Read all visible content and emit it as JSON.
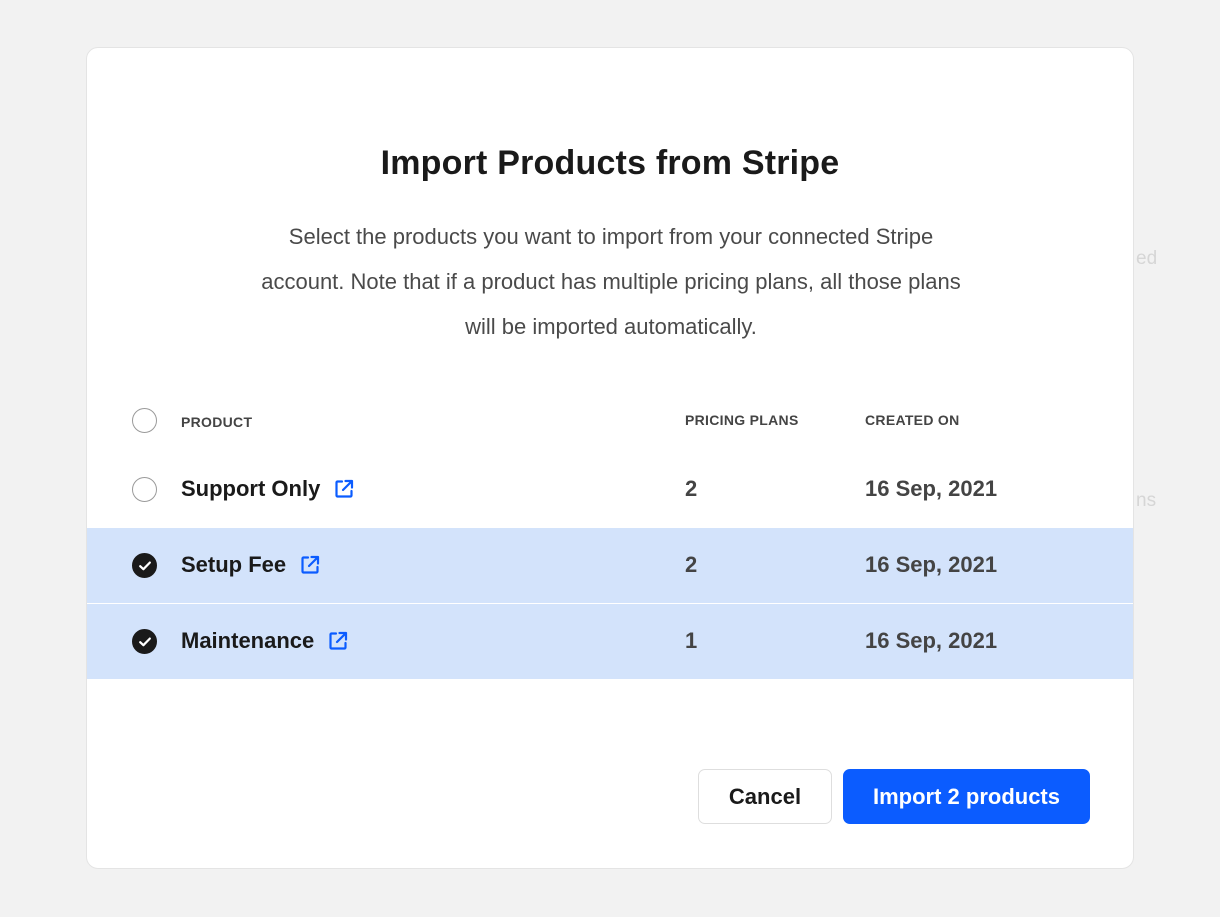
{
  "background": {
    "partial_text_1": "ed",
    "partial_text_2": "ns"
  },
  "modal": {
    "title": "Import Products from Stripe",
    "description": "Select the products you want to import from your connected Stripe account. Note that if a product has multiple pricing plans, all those plans will be imported automatically.",
    "table": {
      "headers": {
        "product": "PRODUCT",
        "pricing_plans": "PRICING PLANS",
        "created_on": "CREATED ON"
      },
      "select_all_checked": false,
      "rows": [
        {
          "name": "Support Only",
          "pricing_plans": "2",
          "created_on": "16 Sep, 2021",
          "selected": false,
          "link_icon": "external-link-icon"
        },
        {
          "name": "Setup Fee",
          "pricing_plans": "2",
          "created_on": "16 Sep, 2021",
          "selected": true,
          "link_icon": "external-link-icon"
        },
        {
          "name": "Maintenance",
          "pricing_plans": "1",
          "created_on": "16 Sep, 2021",
          "selected": true,
          "link_icon": "external-link-icon"
        }
      ]
    },
    "buttons": {
      "cancel": "Cancel",
      "import": "Import 2 products"
    }
  },
  "colors": {
    "accent": "#0b5cff",
    "selected_row": "#d3e3fb",
    "checkbox_checked": "#1a1a1a"
  }
}
